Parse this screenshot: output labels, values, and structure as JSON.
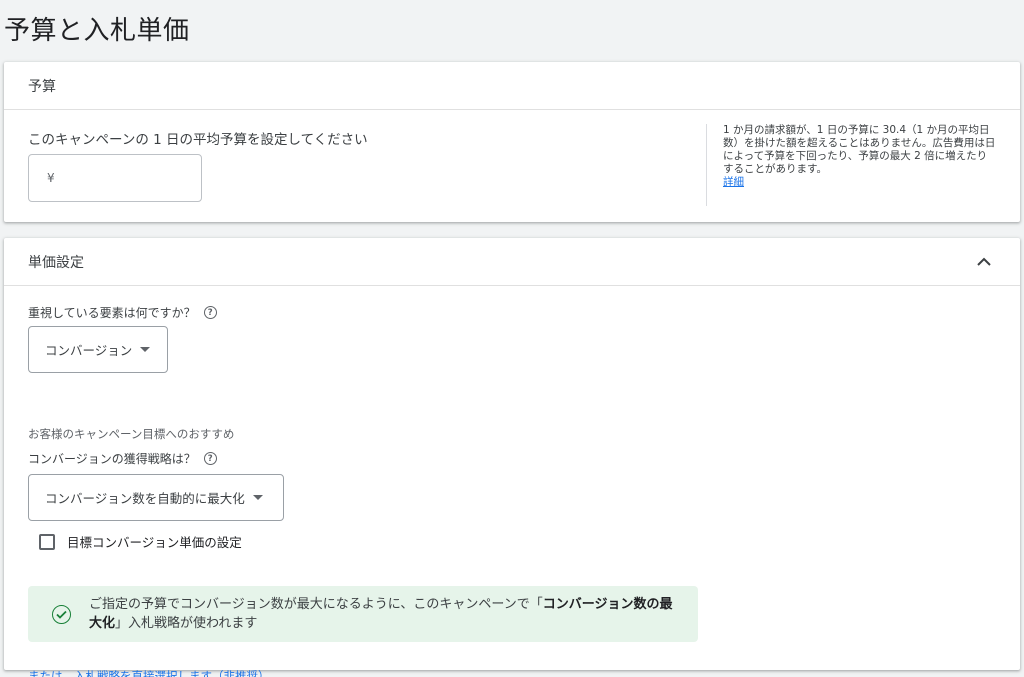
{
  "page": {
    "title": "予算と入札単価"
  },
  "budget": {
    "header": "予算",
    "label": "このキャンペーンの 1 日の平均予算を設定してください",
    "currency_symbol": "¥",
    "input_value": "",
    "note": "1 か月の請求額が、1 日の予算に 30.4（1 か月の平均日数）を掛けた額を超えることはありません。広告費用は日によって予算を下回ったり、予算の最大 2 倍に増えたりすることがあります。",
    "note_link": "詳細"
  },
  "bidding": {
    "header": "単価設定",
    "focus_question": "重視している要素は何ですか？",
    "focus_selected": "コンバージョン",
    "focus_hint": "お客様のキャンペーン目標へのおすすめ",
    "strategy_question": "コンバージョンの獲得戦略は？",
    "strategy_selected": "コンバージョン数を自動的に最大化",
    "target_cpa_checkbox": "目標コンバージョン単価の設定",
    "info_prefix": "ご指定の予算でコンバージョン数が最大になるように、このキャンペーンで「",
    "info_bold": "コンバージョン数の最大化",
    "info_suffix": "」入札戦略が使われます",
    "alt_link": "または、入札戦略を直接選択します（非推奨）"
  },
  "icons": {
    "help": "help-icon",
    "collapse": "chevron-up-icon",
    "success": "check-circle-icon"
  },
  "colors": {
    "accent": "#1a73e8",
    "success": "#188038",
    "success_bg": "#e6f4ea"
  }
}
